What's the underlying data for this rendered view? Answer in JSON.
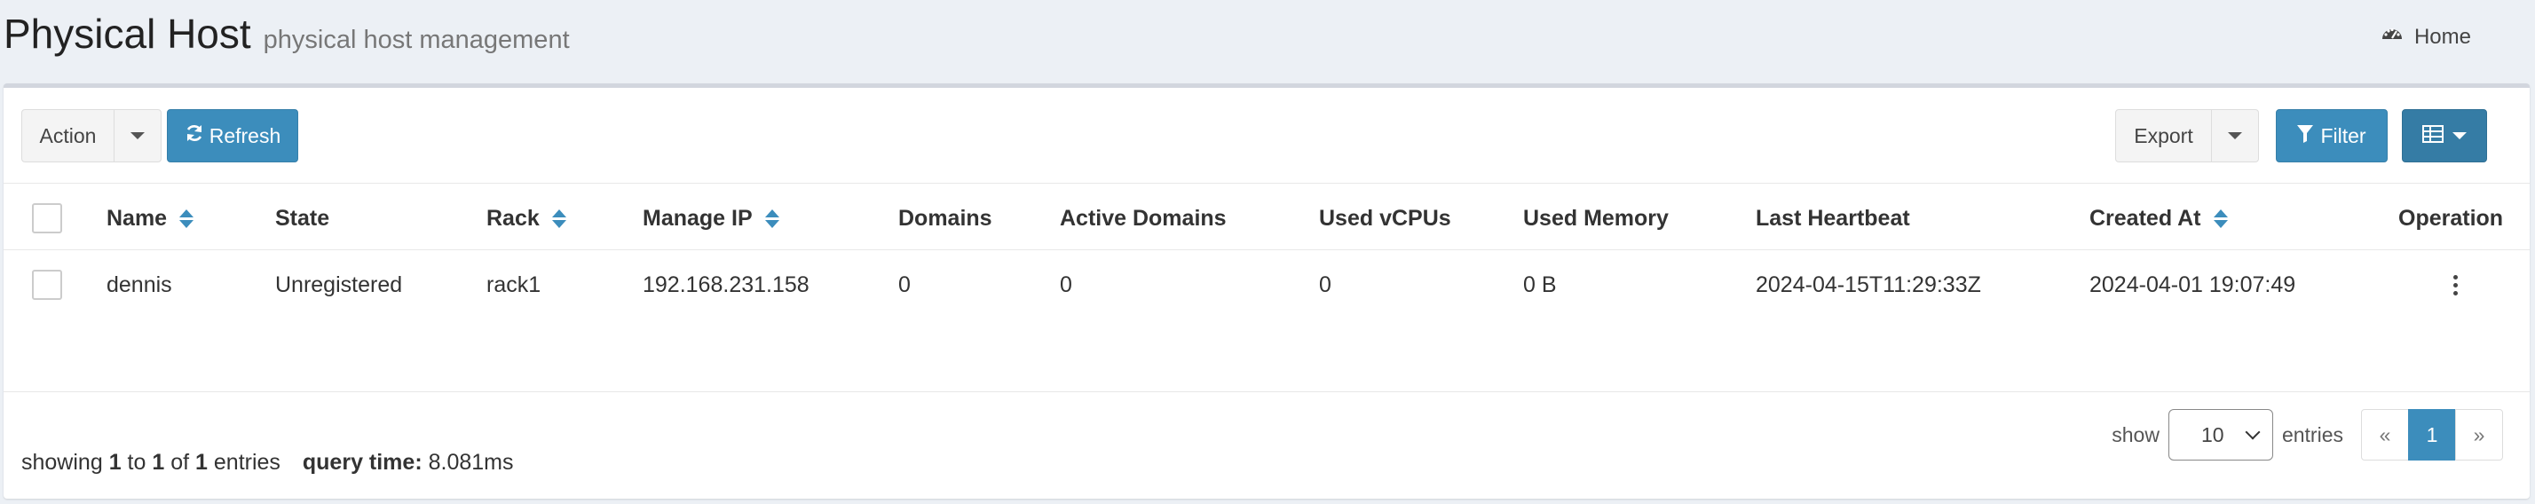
{
  "header": {
    "title": "Physical Host",
    "subtitle": "physical host management",
    "breadcrumb_home": "Home"
  },
  "toolbar": {
    "action_label": "Action",
    "refresh_label": "Refresh",
    "export_label": "Export",
    "filter_label": "Filter"
  },
  "table": {
    "columns": [
      "Name",
      "State",
      "Rack",
      "Manage IP",
      "Domains",
      "Active Domains",
      "Used vCPUs",
      "Used Memory",
      "Last Heartbeat",
      "Created At",
      "Operation"
    ],
    "rows": [
      [
        "dennis",
        "Unregistered",
        "rack1",
        "192.168.231.158",
        "0",
        "0",
        "0",
        "0 B",
        "2024-04-15T11:29:33Z",
        "2024-04-01 19:07:49"
      ]
    ]
  },
  "footer": {
    "showing_prefix": "showing",
    "from": "1",
    "to_word": "to",
    "to": "1",
    "of_word": "of",
    "total": "1",
    "entries_word": "entries",
    "query_time_label": "query time:",
    "query_time_value": "8.081ms",
    "show_label": "show",
    "page_size": "10",
    "entries_label": "entries",
    "pager": {
      "prev": "«",
      "current": "1",
      "next": "»"
    }
  }
}
